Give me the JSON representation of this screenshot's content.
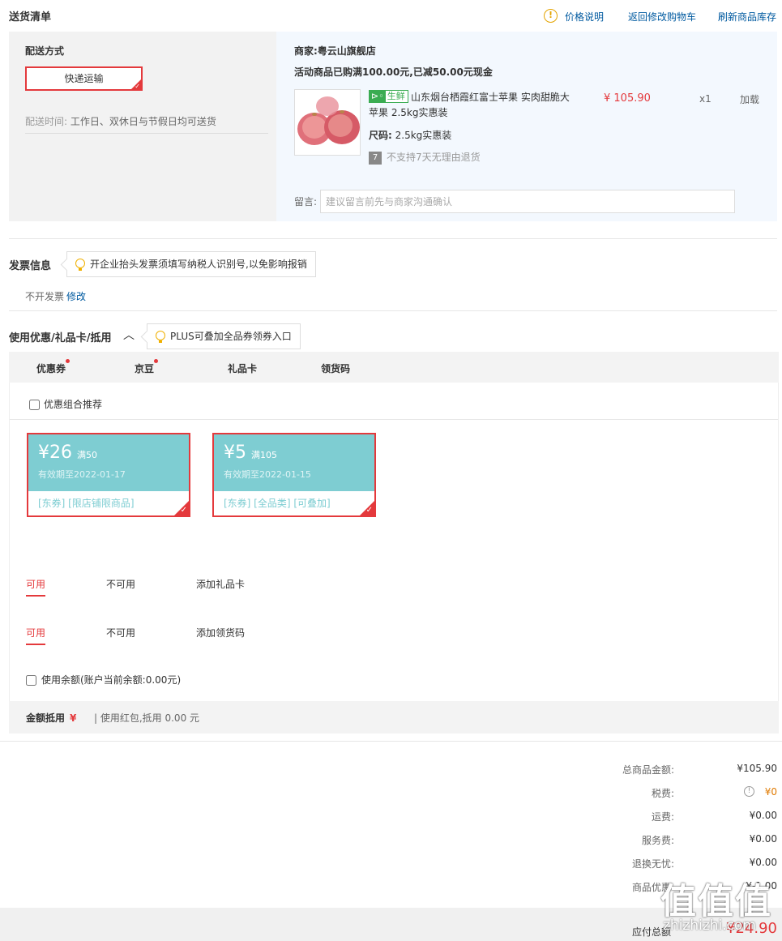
{
  "header": {
    "title": "送货清单",
    "price_explain": "价格说明",
    "back_to_cart": "返回修改购物车",
    "refresh_stock": "刷新商品库存"
  },
  "shipping": {
    "label": "配送方式",
    "method": "快递运输",
    "time_label": "配送时间:",
    "time_value": "工作日、双休日与节假日均可送货"
  },
  "shop": {
    "seller": "商家:粤云山旗舰店",
    "promo": "活动商品已购满100.00元,已减50.00元现金",
    "product": {
      "tag": "生鲜",
      "name": "山东烟台栖霞红富士苹果 实肉甜脆大苹果 2.5kg实惠装",
      "price": "¥ 105.90",
      "qty": "x1",
      "weight": "加载",
      "size_label": "尺码:",
      "size_value": "2.5kg实惠装",
      "no_return_icon": "7",
      "no_return": "不支持7天无理由退货"
    },
    "memo_label": "留言:",
    "memo_placeholder": "建议留言前先与商家沟通确认"
  },
  "invoice": {
    "title": "发票信息",
    "tip": "开企业抬头发票须填写纳税人识别号,以免影响报销",
    "status": "不开发票",
    "modify": "修改"
  },
  "discount": {
    "title": "使用优惠/礼品卡/抵用",
    "tip": "PLUS可叠加全品券领券入口",
    "tabs": [
      "优惠券",
      "京豆",
      "礼品卡",
      "领货码"
    ],
    "combo_label": "优惠组合推荐",
    "coupons": [
      {
        "amount": "¥26",
        "condition": "满50",
        "expiry": "有效期至2022-01-17",
        "tags": "[东券] [限店铺限商品]"
      },
      {
        "amount": "¥5",
        "condition": "满105",
        "expiry": "有效期至2022-01-15",
        "tags": "[东券] [全品类] [可叠加]"
      }
    ],
    "giftcard_tabs": [
      "可用",
      "不可用",
      "添加礼品卡"
    ],
    "code_tabs": [
      "可用",
      "不可用",
      "添加领货码"
    ],
    "balance_label": "使用余额(账户当前余额:0.00元)",
    "deduct_label": "金额抵用",
    "deduct_currency": "¥",
    "deduct_text": "| 使用红包,抵用 0.00 元"
  },
  "summary": {
    "rows": [
      {
        "label": "总商品金额:",
        "value": "¥105.90"
      },
      {
        "label": "税费:",
        "value": "¥0"
      },
      {
        "label": "运费:",
        "value": "¥0.00"
      },
      {
        "label": "服务费:",
        "value": "¥0.00"
      },
      {
        "label": "退换无忧:",
        "value": "¥0.00"
      },
      {
        "label": "商品优惠",
        "value": "¥-1.00"
      }
    ],
    "pay_label": "应付总额",
    "pay_value": "¥24.90"
  },
  "watermark": {
    "logo": "值值值",
    "url": "zhizhizhi.com"
  },
  "colors": {
    "accent": "#e4393c",
    "coupon": "#7ecdd2",
    "link": "#005aa0",
    "fresh": "#3aac52"
  }
}
